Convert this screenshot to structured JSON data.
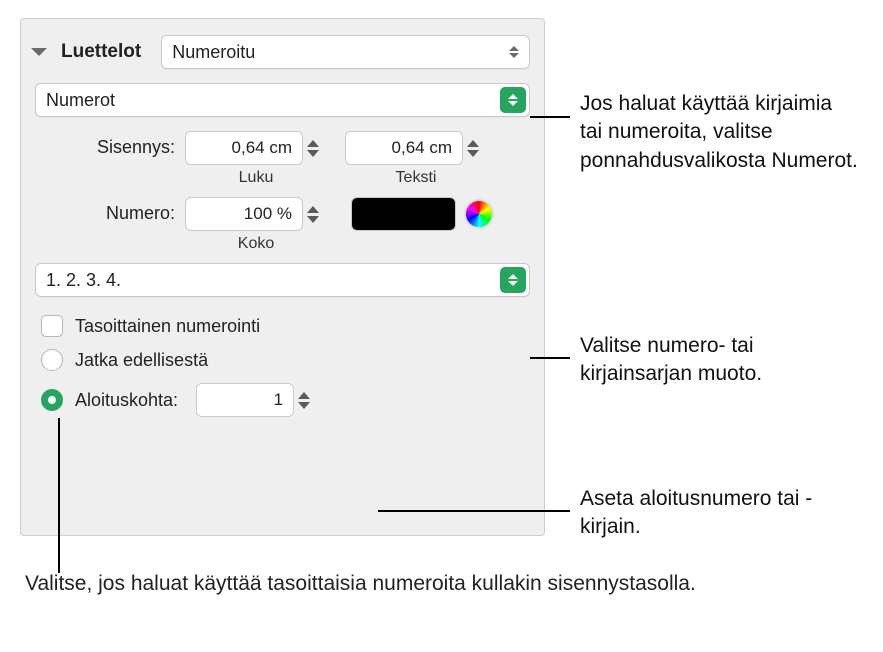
{
  "header": {
    "section_title": "Luettelot",
    "style_select": "Numeroitu"
  },
  "type_select": "Numerot",
  "indent": {
    "label": "Sisennys:",
    "number_value": "0,64 cm",
    "number_sublabel": "Luku",
    "text_value": "0,64 cm",
    "text_sublabel": "Teksti"
  },
  "number_format": {
    "label": "Numero:",
    "size_value": "100 %",
    "size_sublabel": "Koko"
  },
  "sequence_select": "1. 2. 3. 4.",
  "tiered_checkbox_label": "Tasoittainen numerointi",
  "continue_label": "Jatka edellisestä",
  "start_label": "Aloituskohta:",
  "start_value": "1",
  "callouts": {
    "c1": "Jos haluat käyttää kirjaimia tai numeroita, valitse ponnahdusvalikosta Numerot.",
    "c2": "Valitse numero- tai kirjainsarjan muoto.",
    "c3": "Aseta aloitusnumero tai -kirjain.",
    "c4": "Valitse, jos haluat käyttää tasoittaisia numeroita kullakin sisennystasolla."
  }
}
